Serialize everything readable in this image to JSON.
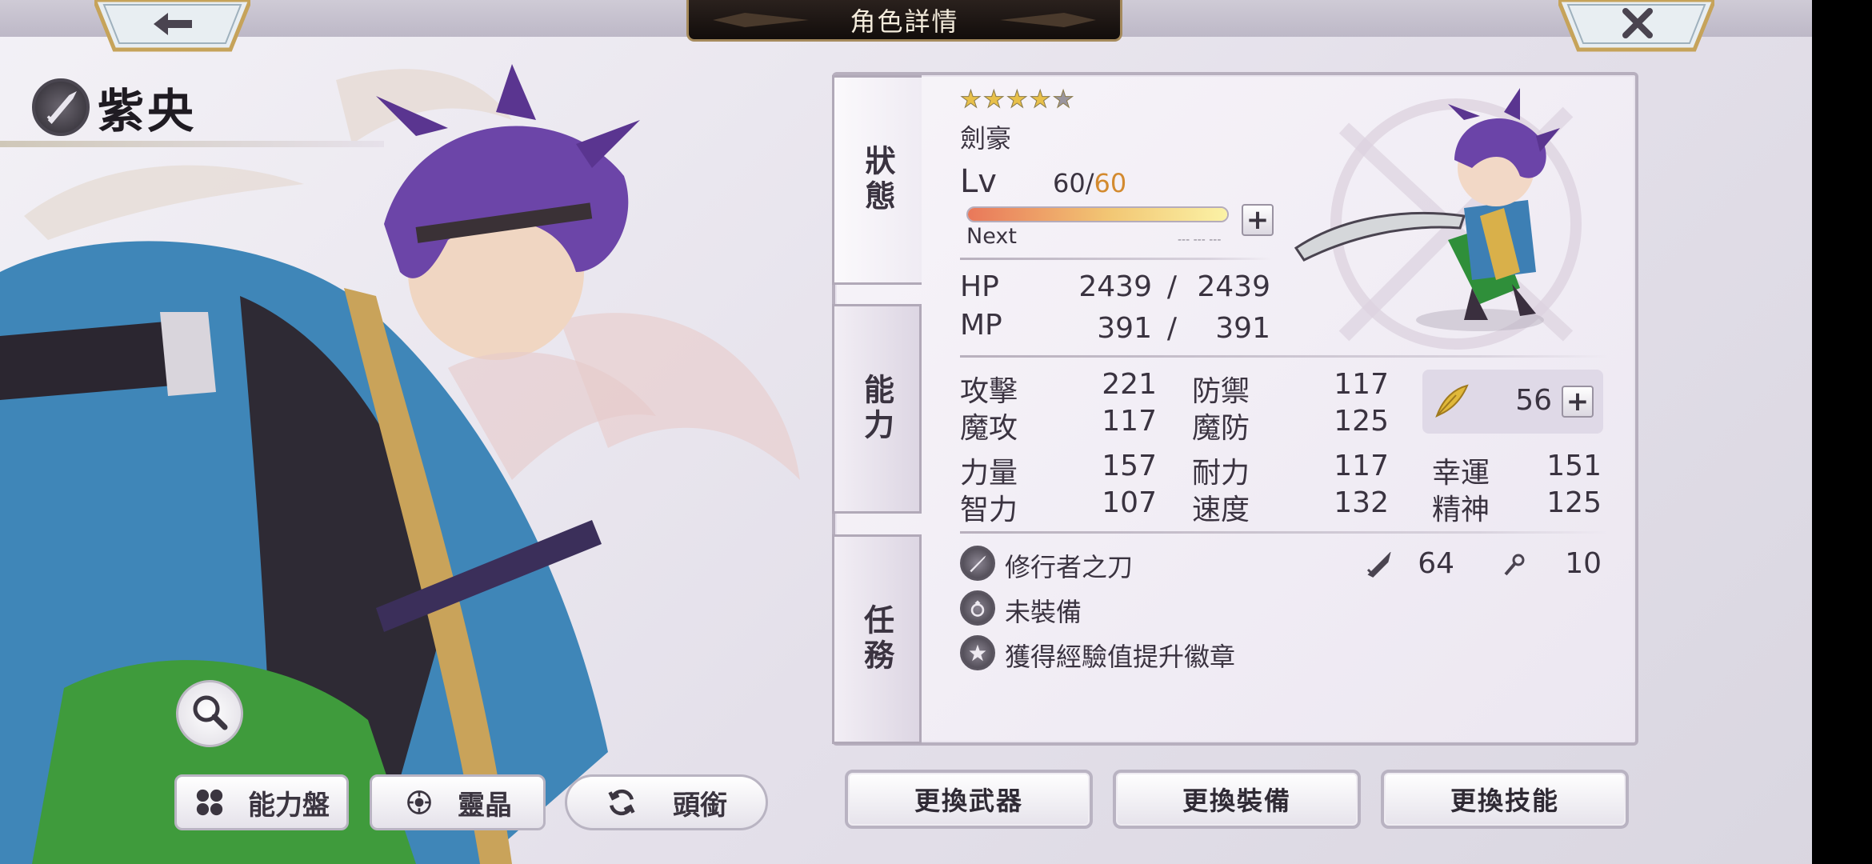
{
  "header": {
    "title": "角色詳情",
    "back_icon": "arrow-left-icon",
    "close_icon": "close-icon"
  },
  "character": {
    "name": "紫央",
    "job": "劍豪",
    "rarity_stars": 4,
    "max_stars": 5,
    "level": "60",
    "level_sep": "/",
    "level_max": "60",
    "next_label": "Next",
    "next_value": "--- --- ---",
    "level_progress": 1.0
  },
  "tabs": [
    {
      "label": "狀態",
      "active": true
    },
    {
      "label": "能力",
      "active": false
    },
    {
      "label": "任務",
      "active": false
    }
  ],
  "stats": {
    "lv_label": "Lv",
    "hp_label": "HP",
    "hp_current": "2439",
    "hp_sep": "/",
    "hp_max": "2439",
    "mp_label": "MP",
    "mp_current": "391",
    "mp_sep": "/",
    "mp_max": "391",
    "attack_label": "攻擊",
    "attack": "221",
    "defense_label": "防禦",
    "defense": "117",
    "magic_attack_label": "魔攻",
    "magic_attack": "117",
    "magic_defense_label": "魔防",
    "magic_defense": "125",
    "strength_label": "力量",
    "strength": "157",
    "endurance_label": "耐力",
    "endurance": "117",
    "luck_label": "幸運",
    "luck": "151",
    "intelligence_label": "智力",
    "intelligence": "107",
    "speed_label": "速度",
    "speed": "132",
    "spirit_label": "精神",
    "spirit": "125",
    "feather_points": "56"
  },
  "equipment": {
    "weapon_name": "修行者之刀",
    "weapon_attack": "64",
    "weapon_magic": "10",
    "accessory": "未裝備",
    "badge": "獲得經驗值提升徽章"
  },
  "bottom_left": {
    "ability_board": "能力盤",
    "spirit_crystal": "靈晶",
    "title_label": "頭銜"
  },
  "actions": {
    "change_weapon": "更換武器",
    "change_equipment": "更換裝備",
    "change_skill": "更換技能"
  },
  "colors": {
    "accent_gold": "#c9a35a",
    "level_max_color": "#d38a2f",
    "star_filled": "#e8c04a",
    "star_empty": "#9a959e"
  }
}
